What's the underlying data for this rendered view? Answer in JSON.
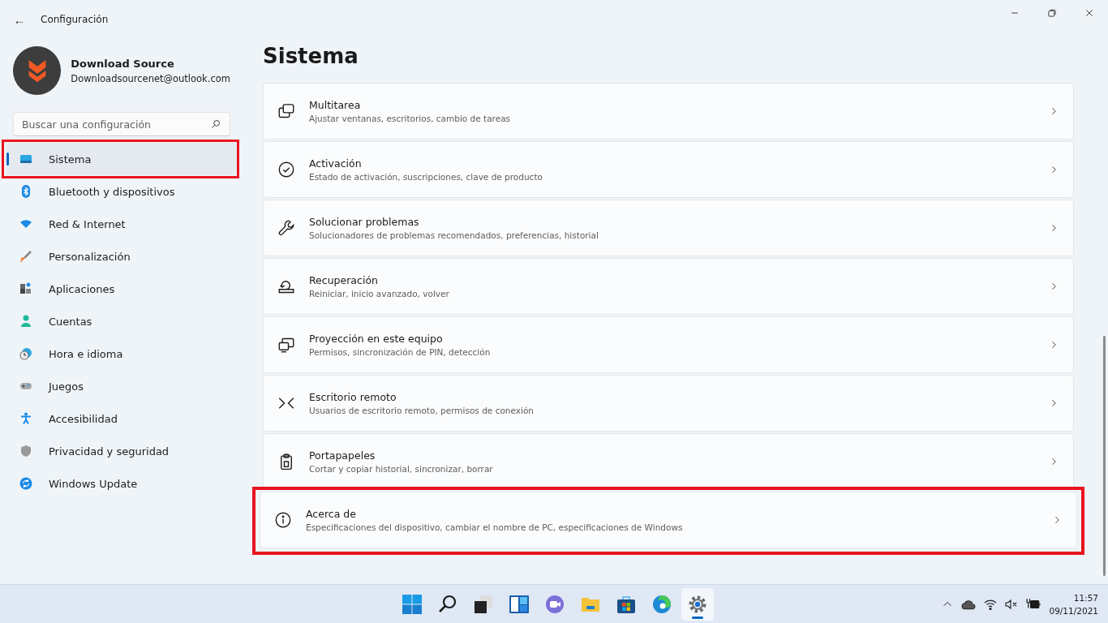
{
  "window": {
    "title": "Configuración",
    "back_label": "←"
  },
  "account": {
    "name": "Download Source",
    "email": "Downloadsourcenet@outlook.com"
  },
  "search": {
    "placeholder": "Buscar una configuración"
  },
  "sidebar": {
    "items": [
      {
        "label": "Sistema",
        "selected": true,
        "highlighted": true
      },
      {
        "label": "Bluetooth y dispositivos",
        "selected": false,
        "highlighted": false
      },
      {
        "label": "Red & Internet",
        "selected": false,
        "highlighted": false
      },
      {
        "label": "Personalización",
        "selected": false,
        "highlighted": false
      },
      {
        "label": "Aplicaciones",
        "selected": false,
        "highlighted": false
      },
      {
        "label": "Cuentas",
        "selected": false,
        "highlighted": false
      },
      {
        "label": "Hora e idioma",
        "selected": false,
        "highlighted": false
      },
      {
        "label": "Juegos",
        "selected": false,
        "highlighted": false
      },
      {
        "label": "Accesibilidad",
        "selected": false,
        "highlighted": false
      },
      {
        "label": "Privacidad y seguridad",
        "selected": false,
        "highlighted": false
      },
      {
        "label": "Windows Update",
        "selected": false,
        "highlighted": false
      }
    ]
  },
  "page": {
    "title": "Sistema",
    "cards": [
      {
        "title": "Multitarea",
        "subtitle": "Ajustar ventanas, escritorios, cambio de tareas",
        "highlighted": false
      },
      {
        "title": "Activación",
        "subtitle": "Estado de activación, suscripciones, clave de producto",
        "highlighted": false
      },
      {
        "title": "Solucionar problemas",
        "subtitle": "Solucionadores de problemas recomendados, preferencias, historial",
        "highlighted": false
      },
      {
        "title": "Recuperación",
        "subtitle": "Reiniciar, inicio avanzado, volver",
        "highlighted": false
      },
      {
        "title": "Proyección en este equipo",
        "subtitle": "Permisos, sincronización de PIN, detección",
        "highlighted": false
      },
      {
        "title": "Escritorio remoto",
        "subtitle": "Usuarios de escritorio remoto, permisos de conexión",
        "highlighted": false
      },
      {
        "title": "Portapapeles",
        "subtitle": "Cortar y copiar historial, sincronizar, borrar",
        "highlighted": false
      },
      {
        "title": "Acerca de",
        "subtitle": "Especificaciones del dispositivo, cambiar el nombre de PC, especificaciones de Windows",
        "highlighted": true
      }
    ]
  },
  "taskbar": {
    "apps": [
      {
        "selected": false
      },
      {
        "selected": false
      },
      {
        "selected": false
      },
      {
        "selected": false
      },
      {
        "selected": false
      },
      {
        "selected": false
      },
      {
        "selected": false
      },
      {
        "selected": false
      },
      {
        "selected": true
      }
    ],
    "time": "11:57",
    "date": "09/11/2021"
  }
}
